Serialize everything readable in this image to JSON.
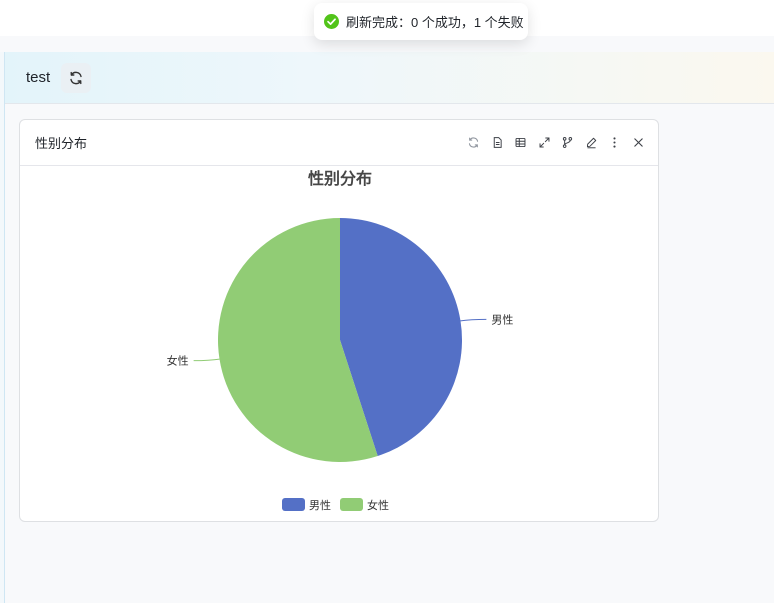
{
  "toast": {
    "message": "刷新完成：0 个成功，1 个失败",
    "icon": "check-circle-icon",
    "color": "#52c41a"
  },
  "toolbar": {
    "title": "test",
    "refresh_icon": "refresh-icon"
  },
  "card": {
    "title": "性别分布",
    "actions": [
      "refresh-icon",
      "document-icon",
      "table-icon",
      "expand-icon",
      "branch-icon",
      "edit-icon",
      "more-icon",
      "close-icon"
    ]
  },
  "chart_data": {
    "type": "pie",
    "title": "性别分布",
    "series": [
      {
        "name": "男性",
        "value": 45,
        "color": "#5470c6"
      },
      {
        "name": "女性",
        "value": 55,
        "color": "#91cc75"
      }
    ],
    "legend_position": "bottom-center"
  }
}
